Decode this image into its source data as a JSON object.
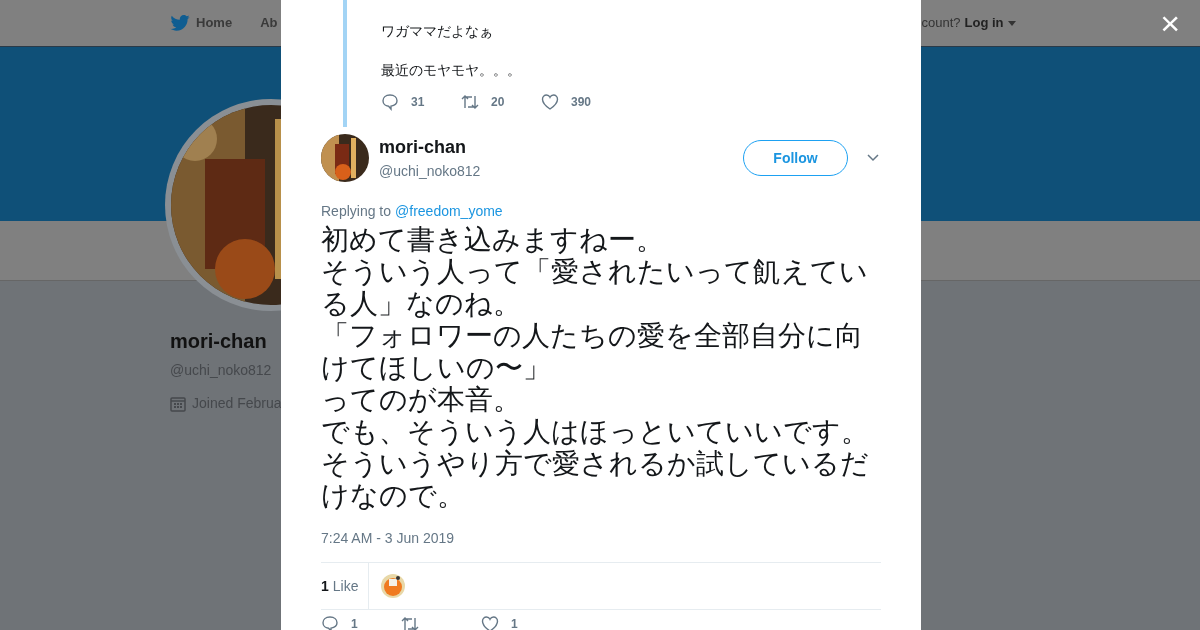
{
  "background_page": {
    "nav": [
      {
        "label": "Home",
        "kind": "home"
      },
      {
        "label": "Ab",
        "kind": "plain"
      }
    ],
    "login_prompt": "count?",
    "login_link": "Log in",
    "profile": {
      "name": "mori-chan",
      "handle": "@uchi_noko812",
      "joined": "Joined Februa"
    }
  },
  "close_label": "×",
  "parent_tweet": {
    "lines": [
      "ワガママだよなぁ",
      "最近のモヤモヤ。。。"
    ],
    "actions": [
      {
        "kind": "reply",
        "count": "31"
      },
      {
        "kind": "retweet",
        "count": "20"
      },
      {
        "kind": "like",
        "count": "390"
      }
    ]
  },
  "tweet": {
    "name": "mori-chan",
    "handle": "@uchi_noko812",
    "follow_label": "Follow",
    "replying_to_label": "Replying to",
    "replying_to": "@freedom_yome",
    "text_lines": [
      "初めて書き込みますねー。",
      "そういう人って「愛されたいって飢えている人」なのね。",
      "「フォロワーの人たちの愛を全部自分に向けてほしいの〜」",
      "ってのが本音。",
      "でも、そういう人はほっといていいです。",
      "そういうやり方で愛されるか試しているだけなので。"
    ],
    "timestamp": "7:24 AM - 3 Jun 2019",
    "likes": {
      "count": "1",
      "label": "Like"
    },
    "actions": [
      {
        "kind": "reply",
        "count": "1"
      },
      {
        "kind": "retweet"
      },
      {
        "kind": "like",
        "count": "1"
      }
    ]
  }
}
